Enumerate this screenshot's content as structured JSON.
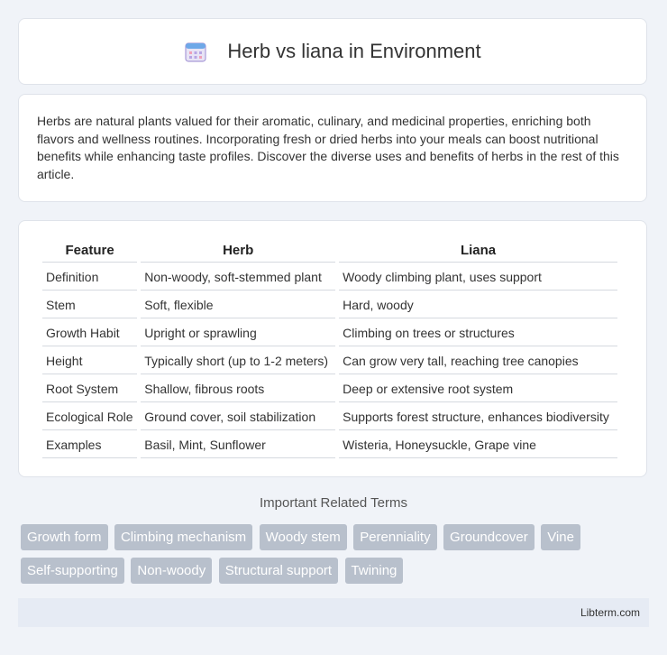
{
  "header": {
    "title": "Herb vs liana in Environment",
    "icon": "calendar-icon"
  },
  "intro": {
    "text": "Herbs are natural plants valued for their aromatic, culinary, and medicinal properties, enriching both flavors and wellness routines. Incorporating fresh or dried herbs into your meals can boost nutritional benefits while enhancing taste profiles. Discover the diverse uses and benefits of herbs in the rest of this article."
  },
  "table": {
    "headers": [
      "Feature",
      "Herb",
      "Liana"
    ],
    "rows": [
      [
        "Definition",
        "Non-woody, soft-stemmed plant",
        "Woody climbing plant, uses support"
      ],
      [
        "Stem",
        "Soft, flexible",
        "Hard, woody"
      ],
      [
        "Growth Habit",
        "Upright or sprawling",
        "Climbing on trees or structures"
      ],
      [
        "Height",
        "Typically short (up to 1-2 meters)",
        "Can grow very tall, reaching tree canopies"
      ],
      [
        "Root System",
        "Shallow, fibrous roots",
        "Deep or extensive root system"
      ],
      [
        "Ecological Role",
        "Ground cover, soil stabilization",
        "Supports forest structure, enhances biodiversity"
      ],
      [
        "Examples",
        "Basil, Mint, Sunflower",
        "Wisteria, Honeysuckle, Grape vine"
      ]
    ]
  },
  "related": {
    "title": "Important Related Terms",
    "tags": [
      "Growth form",
      "Climbing mechanism",
      "Woody stem",
      "Perenniality",
      "Groundcover",
      "Vine",
      "Self-supporting",
      "Non-woody",
      "Structural support",
      "Twining"
    ]
  },
  "footer": {
    "text": "Libterm.com"
  }
}
